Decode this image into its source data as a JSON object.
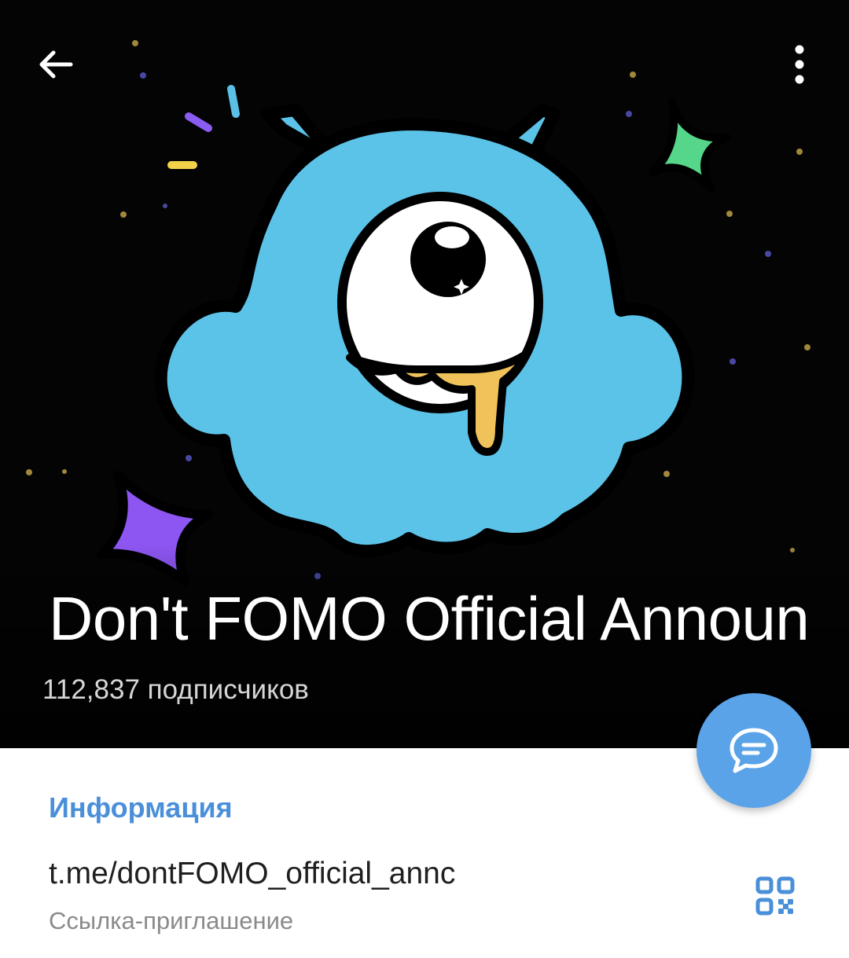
{
  "header": {
    "back_icon": "arrow-left-icon",
    "menu_icon": "more-vertical-icon"
  },
  "channel": {
    "title": "Don't FOMO Official Announ",
    "subscribers": "112,837 подписчиков"
  },
  "fab": {
    "icon": "chat-bubble-icon",
    "color": "#5aa3e8"
  },
  "info": {
    "section_title": "Информация",
    "link": "t.me/dontFOMO_official_annc",
    "link_caption": "Ссылка-приглашение",
    "qr_icon": "qr-code-icon",
    "accent_color": "#4a8fd9"
  }
}
